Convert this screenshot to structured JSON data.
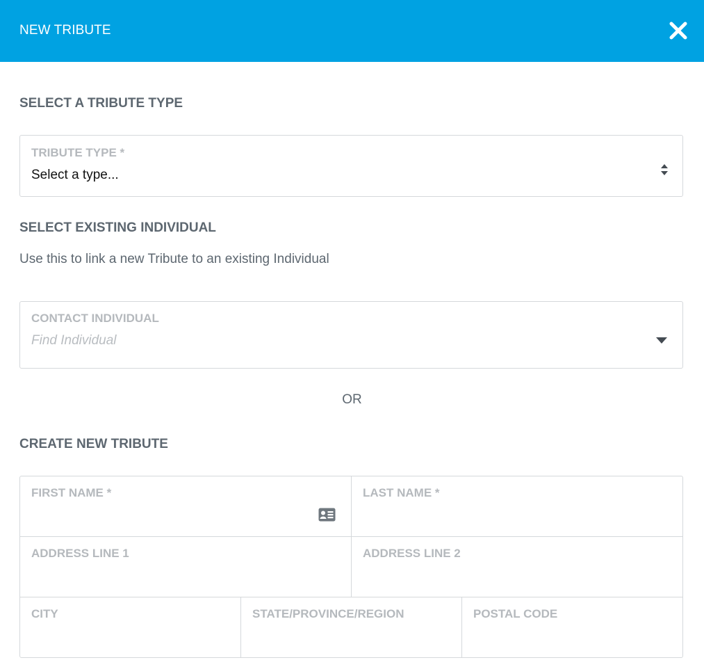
{
  "header": {
    "title": "NEW TRIBUTE",
    "close_icon": "close-icon"
  },
  "tribute_type_section": {
    "title": "SELECT A TRIBUTE TYPE",
    "field": {
      "label": "TRIBUTE TYPE *",
      "value": "Select a type...",
      "icon": "sort-arrows-icon"
    }
  },
  "existing_section": {
    "title": "SELECT EXISTING INDIVIDUAL",
    "description": "Use this to link a new Tribute to an existing Individual",
    "field": {
      "label": "CONTACT INDIVIDUAL",
      "placeholder": "Find Individual",
      "icon": "caret-down-icon"
    }
  },
  "or_text": "OR",
  "create_section": {
    "title": "CREATE NEW TRIBUTE",
    "fields": {
      "first_name": "FIRST NAME *",
      "last_name": "LAST NAME *",
      "address_line_1": "ADDRESS LINE 1",
      "address_line_2": "ADDRESS LINE 2",
      "city": "CITY",
      "state": "STATE/PROVINCE/REGION",
      "postal_code": "POSTAL CODE"
    },
    "first_name_icon": "contact-card-icon"
  },
  "colors": {
    "header_bg": "#00a2e2",
    "text": "#5d6770",
    "label": "#b5b9bd",
    "border": "#d5d8db"
  }
}
